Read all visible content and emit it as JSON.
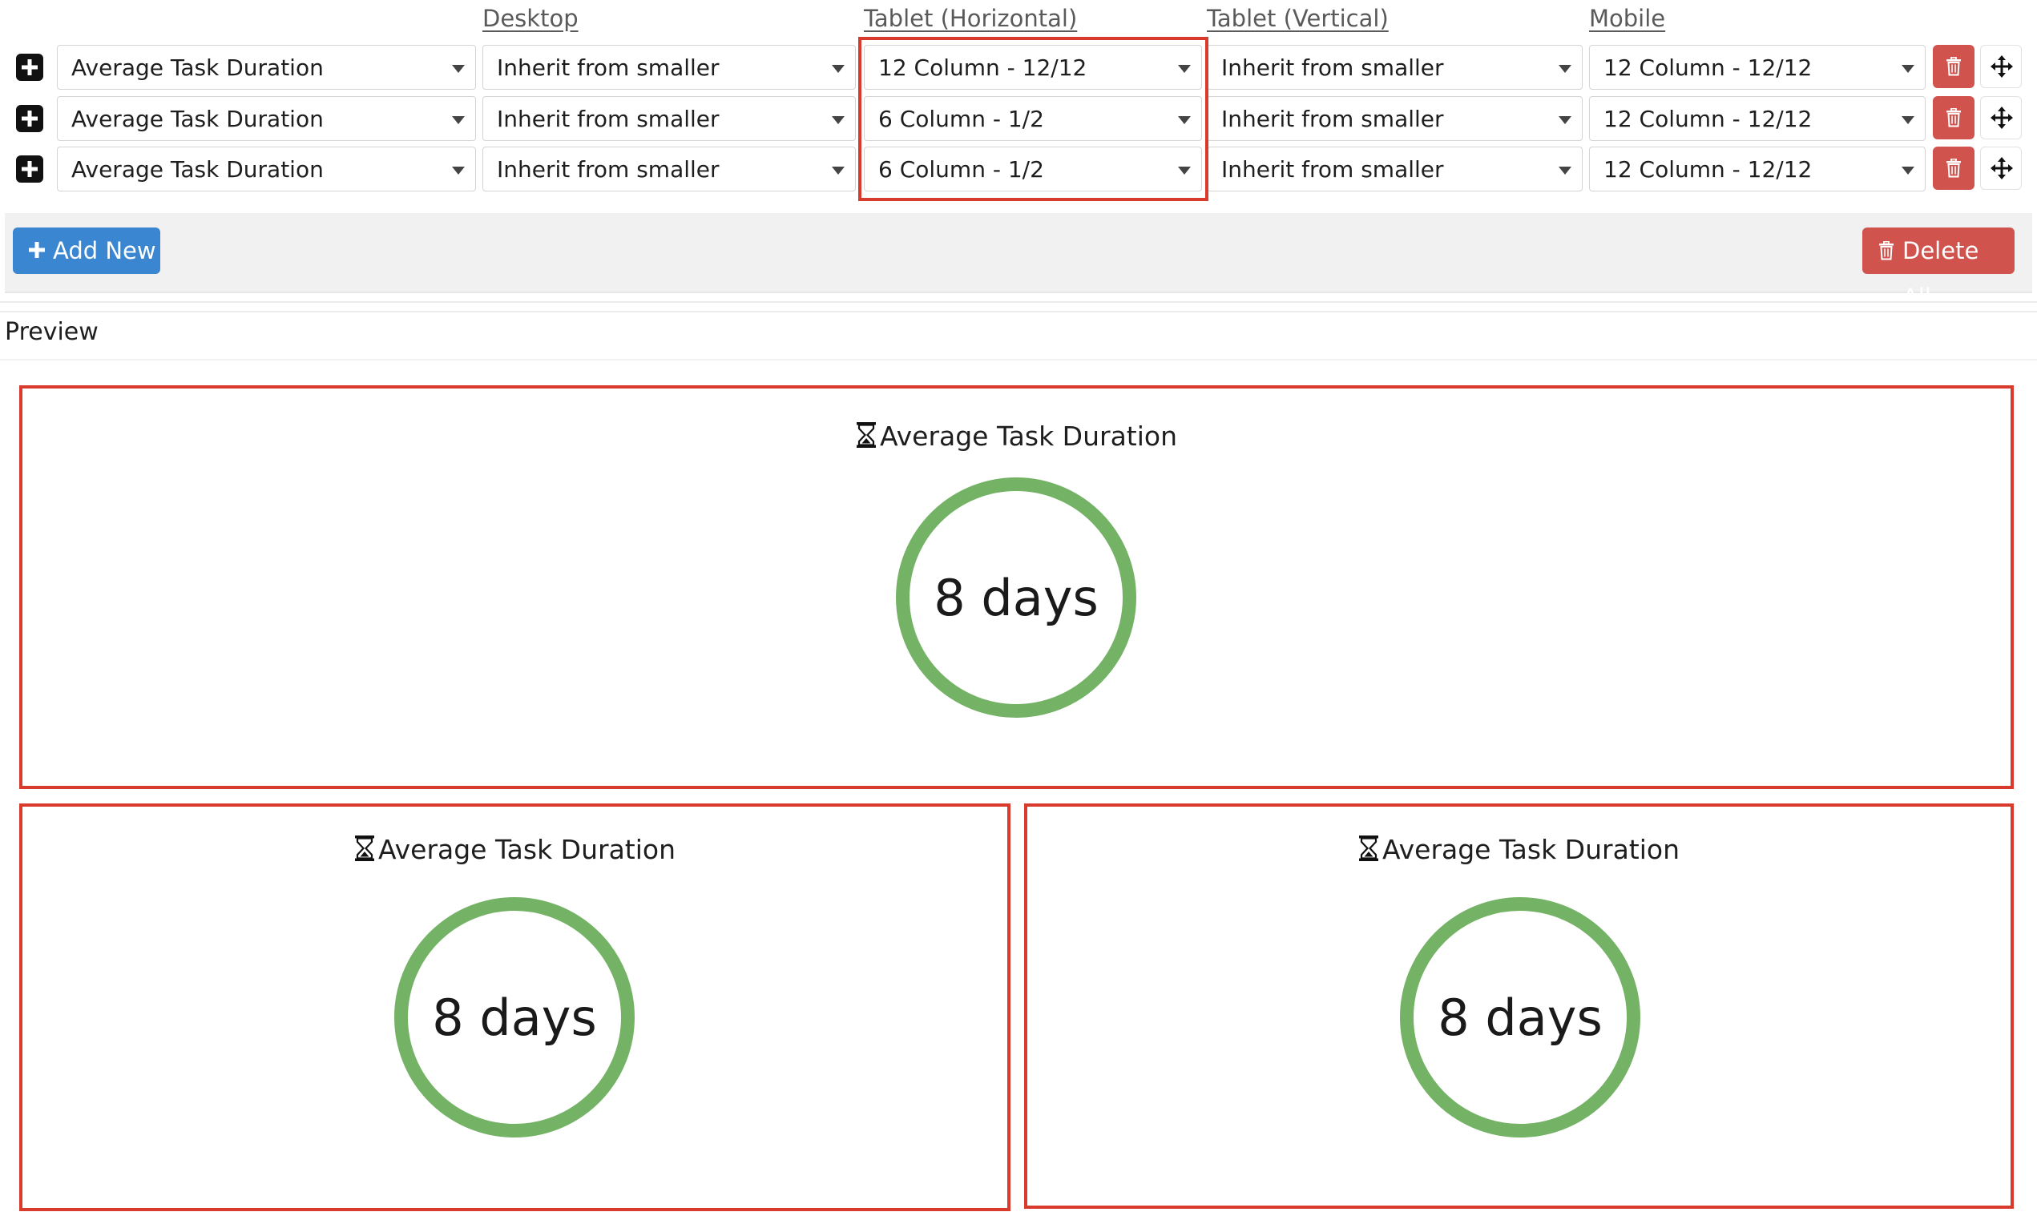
{
  "columns": {
    "desktop": "Desktop",
    "tablet_h": "Tablet (Horizontal)",
    "tablet_v": "Tablet (Vertical)",
    "mobile": "Mobile"
  },
  "rows": [
    {
      "widget": "Average Task Duration",
      "desktop": "Inherit from smaller",
      "tablet_h": "12 Column - 12/12",
      "tablet_v": "Inherit from smaller",
      "mobile": "12 Column - 12/12"
    },
    {
      "widget": "Average Task Duration",
      "desktop": "Inherit from smaller",
      "tablet_h": "6 Column - 1/2",
      "tablet_v": "Inherit from smaller",
      "mobile": "12 Column - 12/12"
    },
    {
      "widget": "Average Task Duration",
      "desktop": "Inherit from smaller",
      "tablet_h": "6 Column - 1/2",
      "tablet_v": "Inherit from smaller",
      "mobile": "12 Column - 12/12"
    }
  ],
  "toolbar": {
    "add_label": "Add New",
    "delete_all_label": "Delete All"
  },
  "preview": {
    "label": "Preview",
    "cards": [
      {
        "title": "Average Task Duration",
        "value": "8 days"
      },
      {
        "title": "Average Task Duration",
        "value": "8 days"
      },
      {
        "title": "Average Task Duration",
        "value": "8 days"
      }
    ]
  },
  "colors": {
    "highlight": "#d83a2c",
    "ring": "#74b366",
    "add_button": "#3b86d1",
    "delete_button": "#d0534e"
  },
  "icons": {
    "row_add": "plus-square-icon",
    "row_delete": "trash-icon",
    "row_move": "move-arrows-icon",
    "card_title": "hourglass-icon"
  }
}
